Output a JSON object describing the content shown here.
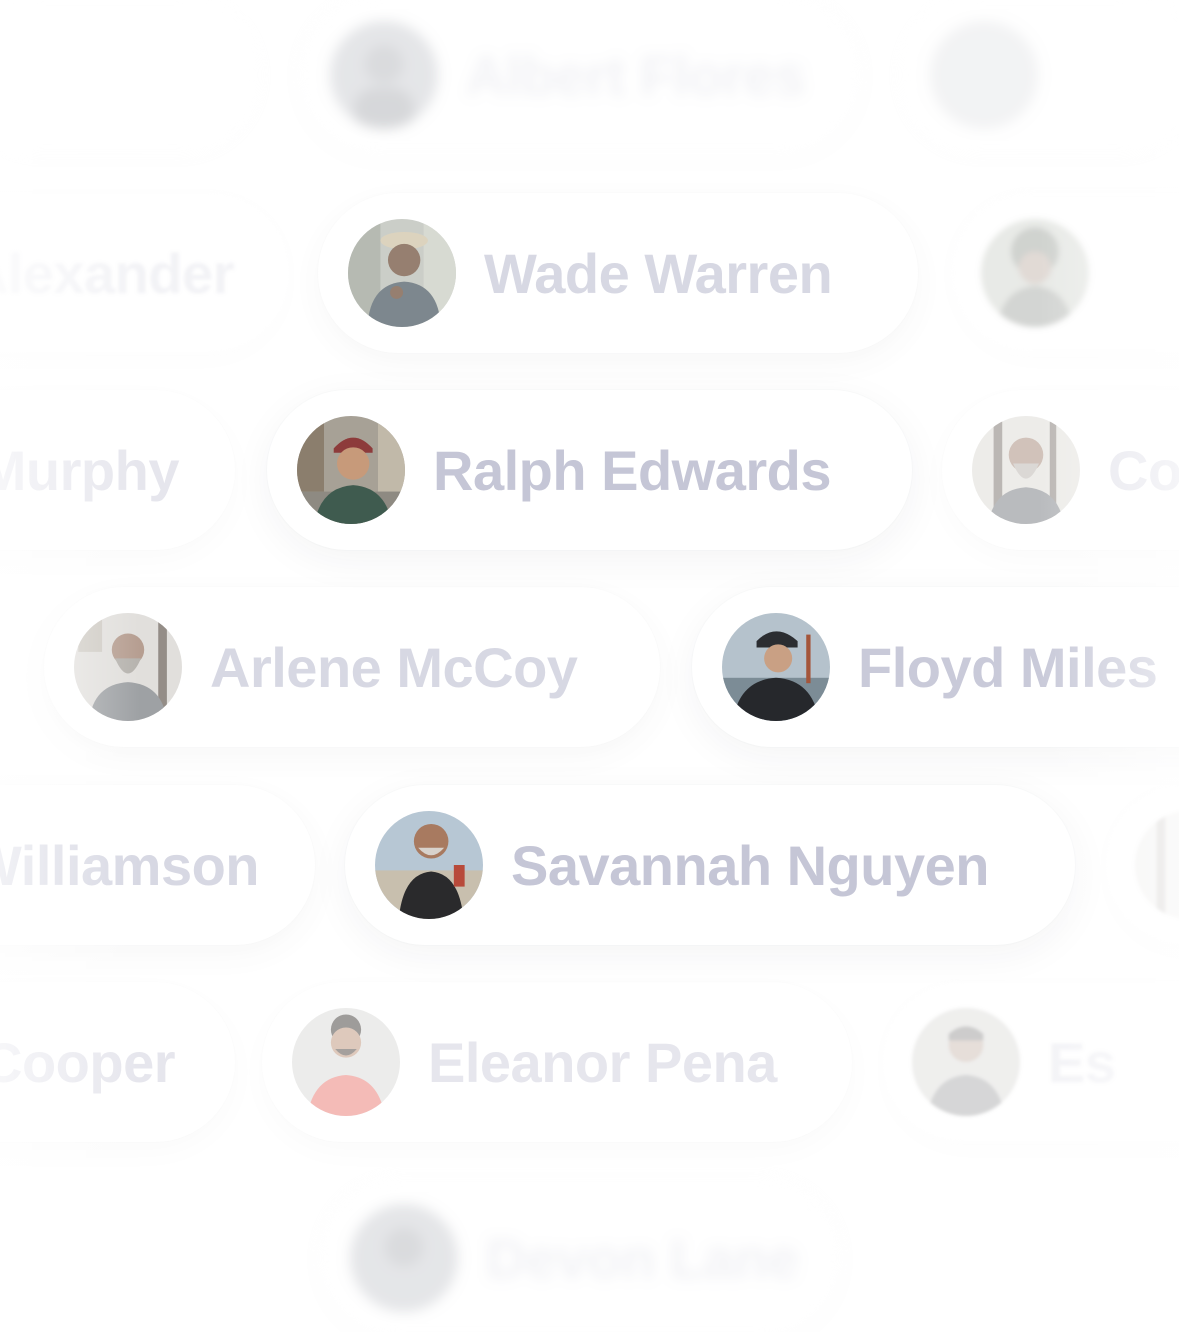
{
  "rows": {
    "top": {
      "center": {
        "name": "Albert Flores"
      }
    },
    "row1": {
      "left": {
        "name": "Alexander"
      },
      "center": {
        "name": "Wade Warren"
      }
    },
    "row2": {
      "left": {
        "name": "Murphy"
      },
      "center": {
        "name": "Ralph Edwards"
      },
      "right": {
        "name": "Co"
      }
    },
    "row3": {
      "left": {
        "name": "Arlene McCoy"
      },
      "right": {
        "name": "Floyd Miles"
      }
    },
    "row4": {
      "left": {
        "name": "Williamson"
      },
      "center": {
        "name": "Savannah Nguyen"
      }
    },
    "row5": {
      "left": {
        "name": "Cooper"
      },
      "center": {
        "name": "Eleanor Pena"
      },
      "right": {
        "name": "Es"
      }
    },
    "bottom": {
      "center": {
        "name": "Devon Lane"
      }
    }
  },
  "colors": {
    "name_text": "#c9cad9",
    "pill_bg": "#ffffff",
    "page_bg": "#ffffff"
  }
}
